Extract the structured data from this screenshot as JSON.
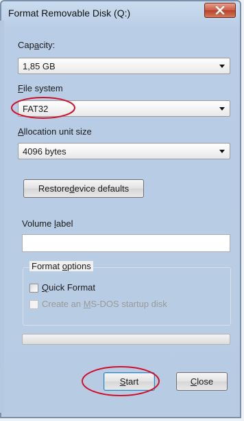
{
  "window": {
    "title": "Format Removable Disk (Q:)"
  },
  "capacity": {
    "label_pre": "Cap",
    "label_key": "a",
    "label_post": "city:",
    "value": "1,85 GB"
  },
  "file_system": {
    "label_pre": "",
    "label_key": "F",
    "label_post": "ile system",
    "value": "FAT32"
  },
  "allocation": {
    "label_pre": "",
    "label_key": "A",
    "label_post": "llocation unit size",
    "value": "4096 bytes"
  },
  "restore_button": {
    "pre": "Restore ",
    "key": "d",
    "post": "evice defaults"
  },
  "volume_label": {
    "pre": "Volume ",
    "key": "l",
    "post": "abel",
    "value": ""
  },
  "format_options": {
    "title_pre": "Format ",
    "title_key": "o",
    "title_post": "ptions",
    "quick_format": {
      "pre": "",
      "key": "Q",
      "post": "uick Format",
      "checked": false
    },
    "msdos": {
      "pre": "Create an ",
      "key": "M",
      "post": "S-DOS startup disk",
      "checked": false,
      "enabled": false
    }
  },
  "progress": {
    "value": 0
  },
  "start_button": {
    "pre": "",
    "key": "S",
    "post": "tart"
  },
  "close_button": {
    "pre": "",
    "key": "C",
    "post": "lose"
  },
  "colors": {
    "annotation": "#d0102a",
    "titlebar": "#b9cde6",
    "close": "#c95a40"
  }
}
